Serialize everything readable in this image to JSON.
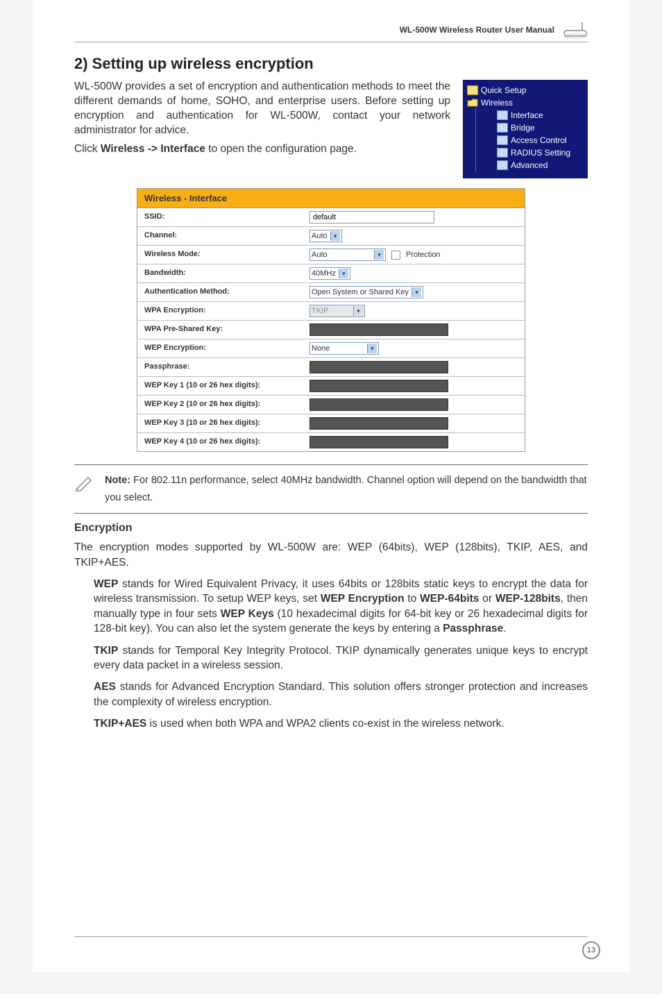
{
  "header": {
    "doc_title": "WL-500W Wireless Router User Manual"
  },
  "section": {
    "title": "2) Setting up wireless encryption",
    "intro_p1": "WL-500W provides a set of encryption and authentication methods to meet the different demands of home, SOHO, and enterprise users. Before setting up encryption and authentication for WL-500W, contact your network administrator for advice.",
    "intro_p2_pre": "Click ",
    "intro_p2_bold": "Wireless -> Interface",
    "intro_p2_post": " to open the configuration page."
  },
  "nav": {
    "items": [
      "Quick Setup",
      "Wireless",
      "Interface",
      "Bridge",
      "Access Control",
      "RADIUS Setting",
      "Advanced"
    ]
  },
  "config_table": {
    "caption": "Wireless - Interface",
    "rows": {
      "ssid_label": "SSID:",
      "ssid_value": "default",
      "channel_label": "Channel:",
      "channel_value": "Auto",
      "wmode_label": "Wireless Mode:",
      "wmode_value": "Auto",
      "protection_label": "Protection",
      "bandwidth_label": "Bandwidth:",
      "bandwidth_value": "40MHz",
      "auth_label": "Authentication Method:",
      "auth_value": "Open System or Shared Key",
      "wpa_enc_label": "WPA Encryption:",
      "wpa_enc_value": "TKIP",
      "wpa_psk_label": "WPA Pre-Shared Key:",
      "wep_enc_label": "WEP Encryption:",
      "wep_enc_value": "None",
      "passphrase_label": "Passphrase:",
      "wep1_label": "WEP Key 1 (10 or 26 hex digits):",
      "wep2_label": "WEP Key 2 (10 or 26 hex digits):",
      "wep3_label": "WEP Key 3 (10 or 26 hex digits):",
      "wep4_label": "WEP Key 4 (10 or 26 hex digits):"
    }
  },
  "note": {
    "prefix": "Note:",
    "text": " For 802.11n performance, select 40MHz bandwidth. Channel option will depend on the bandwidth that you select."
  },
  "encryption": {
    "heading": "Encryption",
    "para1": "The encryption modes supported by WL-500W are: WEP (64bits), WEP (128bits), TKIP, AES, and TKIP+AES.",
    "wep": {
      "b1": "WEP",
      "t1": " stands for Wired Equivalent Privacy, it uses 64bits or 128bits static keys to encrypt the data for wireless transmission. To setup WEP keys, set ",
      "b2": "WEP Encryption",
      "t2": " to ",
      "b3": "WEP-64bits",
      "t3": " or ",
      "b4": "WEP-128bits",
      "t4": ", then manually type in four sets ",
      "b5": "WEP Keys",
      "t5": " (10 hexadecimal digits for 64-bit key or 26 hexadecimal digits for 128-bit key). You can also let the system generate the keys by entering a ",
      "b6": "Passphrase",
      "t6": "."
    },
    "tkip": {
      "b1": "TKIP",
      "t1": " stands for Temporal Key Integrity Protocol. TKIP dynamically generates unique keys to encrypt every data packet in a wireless session."
    },
    "aes": {
      "b1": "AES",
      "t1": " stands for Advanced Encryption Standard. This solution offers stronger protection and increases the complexity of wireless encryption."
    },
    "tkipaes": {
      "b1": "TKIP+AES",
      "t1": " is used when both WPA and WPA2 clients co-exist in the wireless network."
    }
  },
  "page_number": "13"
}
